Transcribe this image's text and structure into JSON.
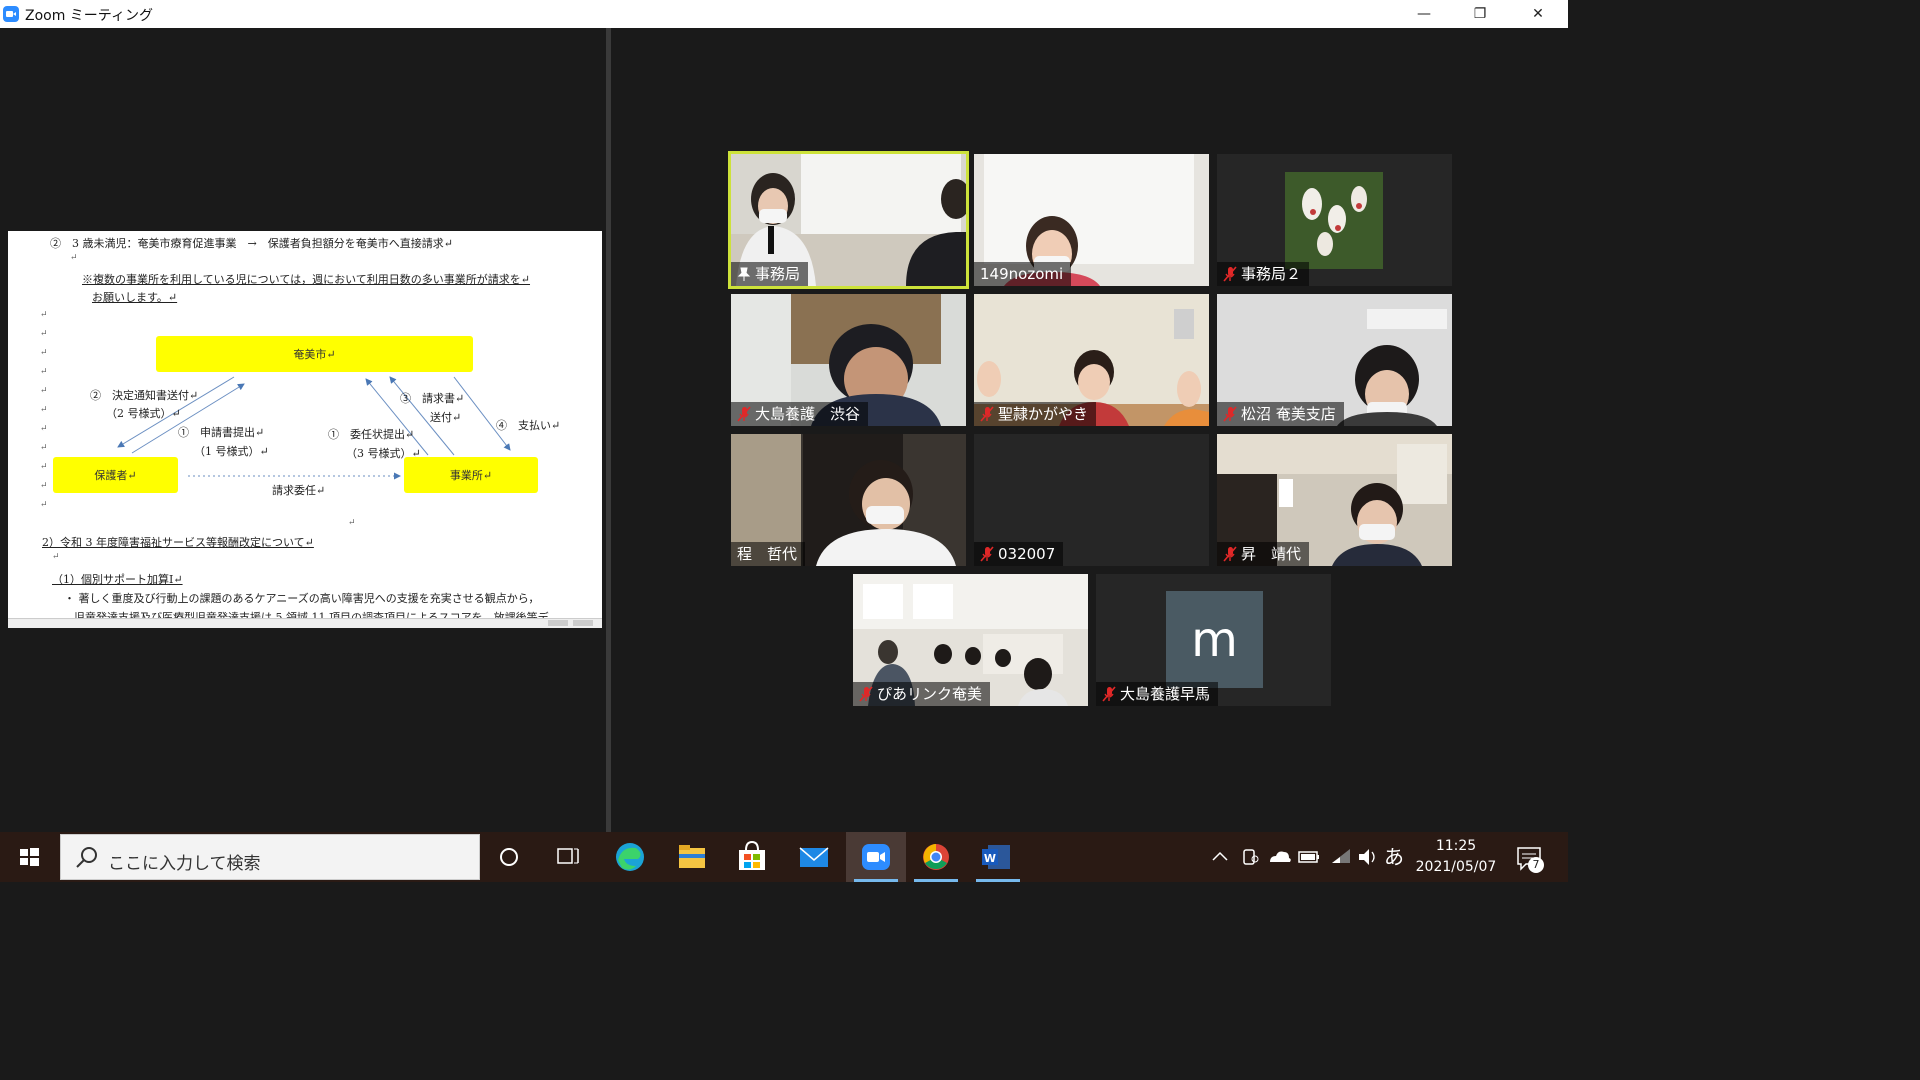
{
  "window": {
    "title": "Zoom ミーティング",
    "buttons": {
      "minimize": "—",
      "restore": "❐",
      "close": "✕"
    }
  },
  "shared_document": {
    "lines": [
      "②　3 歳未満児：奄美市療育促進事業　→　保護者負担額分を奄美市へ直接請求↵",
      "↵",
      "※複数の事業所を利用している児については，週において利用日数の多い事業所が請求を↵",
      "お願いします。↵",
      "2）令和 3 年度障害福祉サービス等報酬改定について↵",
      "↵",
      "（1）個別サポート加算Ⅰ↵",
      "・ 著しく重度及び行動上の課題のあるケアニーズの高い障害児への支援を充実させる観点から，",
      "児童発達支援及び医療型児童発達支援は 5 領域 11 項目の調査項目によるスコアを，放課後等デ"
    ],
    "diagram": {
      "city": "奄美市↵",
      "guardian": "保護者↵",
      "office": "事業所↵",
      "label_decision_1": "②　決定通知書送付↵",
      "label_decision_2": "（2 号様式）↵",
      "label_apply_1": "①　申請書提出↵",
      "label_apply_2": "（1 号様式）↵",
      "label_consign_1": "①　委任状提出↵",
      "label_consign_2": "（3 号様式）↵",
      "label_invoice_1": "③　請求書↵",
      "label_invoice_2": "送付↵",
      "label_payment": "④　支払い↵",
      "label_delegate": "請求委任↵",
      "return_mark": "↵"
    }
  },
  "participants": [
    {
      "name": "事務局",
      "muted": false,
      "active": true
    },
    {
      "name": "149nozomi",
      "muted": false,
      "active": false
    },
    {
      "name": "事務局２",
      "muted": true,
      "active": false
    },
    {
      "name": "大島養護　渋谷",
      "muted": true,
      "active": false
    },
    {
      "name": "聖隷かがやき",
      "muted": true,
      "active": false
    },
    {
      "name": "松沼 奄美支店",
      "muted": true,
      "active": false
    },
    {
      "name": "程　哲代",
      "muted": false,
      "active": false
    },
    {
      "name": "032007",
      "muted": true,
      "active": false
    },
    {
      "name": "昇　靖代",
      "muted": true,
      "active": false
    },
    {
      "name": "ぴあリンク奄美",
      "muted": true,
      "active": false
    },
    {
      "name": "大島養護早馬",
      "muted": true,
      "active": false,
      "avatar_letter": "m"
    }
  ],
  "taskbar": {
    "search_placeholder": "ここに入力して検索",
    "ime": "あ",
    "time": "11:25",
    "date": "2021/05/07",
    "notification_count": "7",
    "apps": [
      "cortana-icon",
      "task-view-icon",
      "edge-icon",
      "file-explorer-icon",
      "store-icon",
      "mail-icon",
      "zoom-icon",
      "chrome-icon",
      "word-icon"
    ]
  },
  "colors": {
    "highlight_yellow": "#ffff00",
    "active_speaker": "#cde23a",
    "muted_red": "#e02828",
    "zoom_blue": "#2d8cff"
  }
}
